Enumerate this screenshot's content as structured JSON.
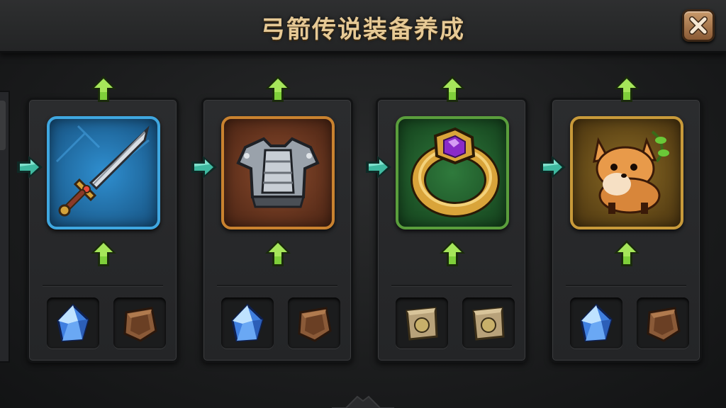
{
  "title": "弓箭传说装备养成",
  "close_label": "close",
  "colors": {
    "title_gold": "#e6c995",
    "upgrade_green": "#7fcf3a",
    "arrow_teal": "#3fb9a0",
    "frame_blue": "#3fa7e0",
    "frame_orange": "#c9822f",
    "frame_green": "#5a9e3c",
    "frame_gold": "#c89a3a"
  },
  "equipment": [
    {
      "name": "sword",
      "icon": "sword-icon",
      "frame_color": "blue",
      "materials": [
        "blue-crystal-icon",
        "brown-ore-icon"
      ]
    },
    {
      "name": "armor",
      "icon": "armor-icon",
      "frame_color": "orange",
      "materials": [
        "blue-crystal-icon",
        "brown-ore-icon"
      ]
    },
    {
      "name": "ring",
      "icon": "ring-icon",
      "frame_color": "green",
      "materials": [
        "tan-scroll-icon",
        "tan-scroll-icon"
      ]
    },
    {
      "name": "pet",
      "icon": "fox-pet-icon",
      "frame_color": "gold",
      "materials": [
        "blue-crystal-icon",
        "brown-ore-icon"
      ]
    }
  ]
}
